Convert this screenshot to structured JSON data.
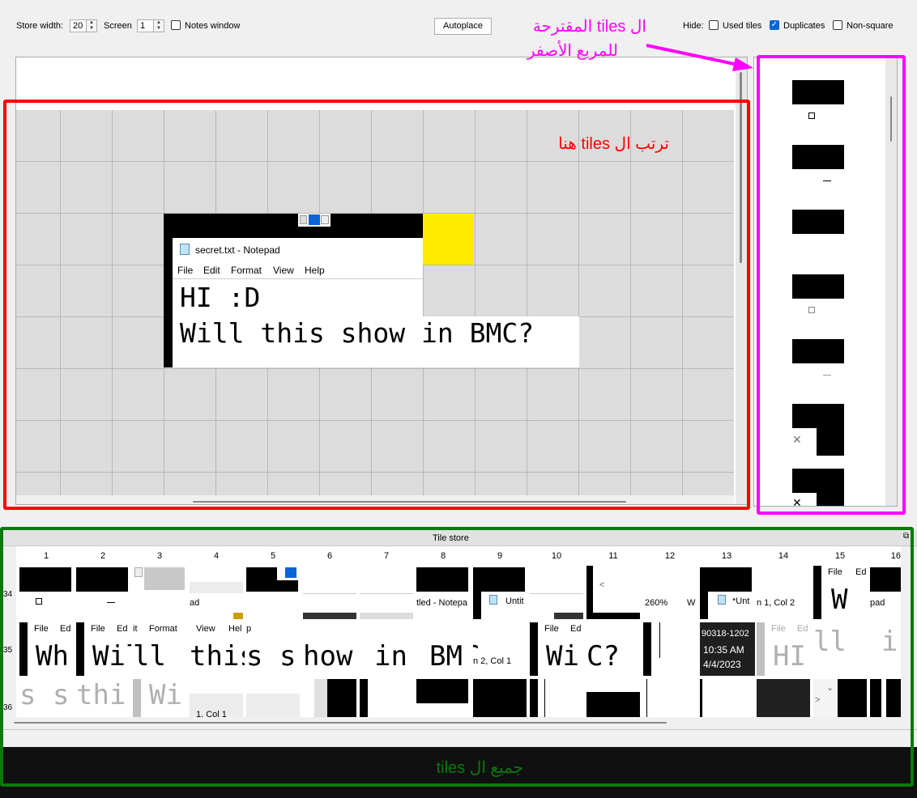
{
  "toolbar": {
    "store_width_label": "Store width:",
    "store_width_value": "20",
    "screen_label": "Screen",
    "screen_value": "1",
    "notes_window_label": "Notes window",
    "autoplace_label": "Autoplace",
    "hide_label": "Hide:",
    "used_tiles_label": "Used tiles",
    "duplicates_label": "Duplicates",
    "non_square_label": "Non-square"
  },
  "notepad": {
    "title": "secret.txt - Notepad",
    "menu": [
      "File",
      "Edit",
      "Format",
      "View",
      "Help"
    ],
    "line1": "HI :D",
    "line2": "Will this show in BMC?"
  },
  "annotations": {
    "magenta_line1": "ال tiles المقترحة",
    "magenta_line2": "للمربع الأصفر",
    "red_text": "ترتب ال tiles هنا",
    "green_text": "جميع ال tiles"
  },
  "tile_store": {
    "title": "Tile store",
    "columns": [
      "1",
      "2",
      "3",
      "4",
      "5",
      "6",
      "7",
      "8",
      "9",
      "10",
      "11",
      "12",
      "13",
      "14",
      "15",
      "16"
    ],
    "rows": [
      "34",
      "35",
      "36"
    ],
    "row34": {
      "c4": "ad",
      "c8": "tled - Notepa",
      "c9": "Untit",
      "c12a": "260%",
      "c12b": "W",
      "c13": "*Unt",
      "c14": "n 1, Col 2",
      "c15a": "File",
      "c15b": "Ed",
      "c15big": "W",
      "c16": "pad"
    },
    "row35": {
      "c1a": "File",
      "c1b": "Ed",
      "c1big": "Wh",
      "c2a": "File",
      "c2b": "Ed",
      "c2big": "Wil",
      "c3a": "it",
      "c3b": "Format",
      "c3big": "ll ",
      "c4a": "View",
      "c4b": "Hel",
      "c4big": "this",
      "c5a": "p",
      "c5big": "s s",
      "c6big": "how",
      "c7big": "in",
      "c8big": "BM",
      "c9big": "C",
      "c9sm": "n 2, Col 1",
      "c10a": "File",
      "c10b": "Ed",
      "c10big": "Wi",
      "c11big": "C?",
      "c13a": "90318-1202",
      "c13b": "10:35 AM",
      "c13c": "4/4/2023",
      "c14a": "File",
      "c14b": "Ed",
      "c14big": "HI",
      "c15big": "ll",
      "c16big": "i"
    },
    "row36": {
      "c1big": "s s",
      "c2big": "thi",
      "c3big": "Wi",
      "c4sm": "1, Col 1"
    }
  },
  "colors": {
    "red": "#ff0000",
    "magenta": "#ff00ff",
    "green": "#0a7a0a",
    "yellow": "#ffea00",
    "checkbox_on": "#0a64d8"
  }
}
